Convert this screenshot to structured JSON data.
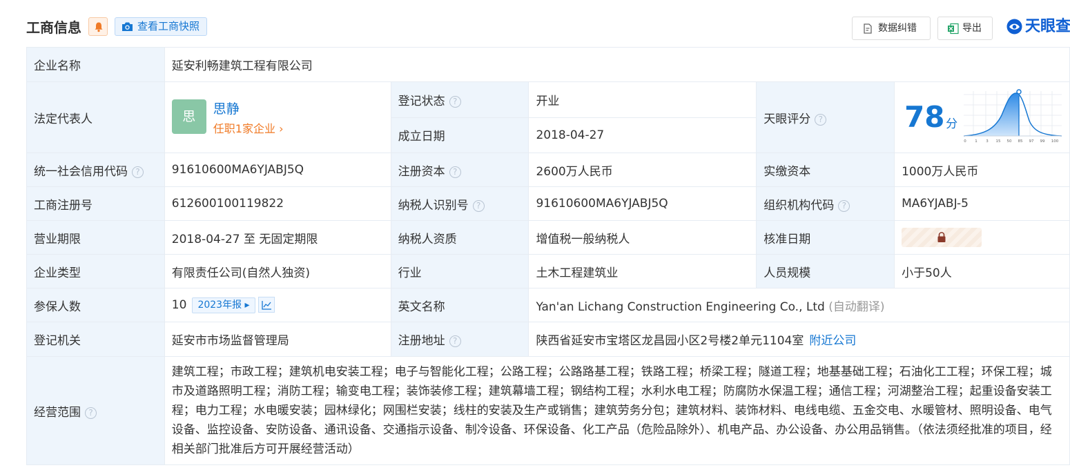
{
  "header": {
    "title": "工商信息",
    "snapshot_label": "查看工商快照",
    "correct_label": "数据纠错",
    "export_label": "导出",
    "logo_text": "天眼查"
  },
  "rows": {
    "company_name": {
      "label": "企业名称",
      "value": "延安利畅建筑工程有限公司"
    },
    "legal_rep": {
      "label": "法定代表人",
      "avatar_char": "思",
      "name": "思静",
      "sub": "任职1家企业 ›"
    },
    "reg_status": {
      "label": "登记状态",
      "value": "开业"
    },
    "found_date": {
      "label": "成立日期",
      "value": "2018-04-27"
    },
    "tianyan_score": {
      "label": "天眼评分",
      "value": "78",
      "unit": "分",
      "axis_ticks": [
        "0",
        "1",
        "3",
        "15",
        "50",
        "85",
        "97",
        "99",
        "100"
      ]
    },
    "credit_code": {
      "label": "统一社会信用代码",
      "value": "91610600MA6YJABJ5Q"
    },
    "reg_capital": {
      "label": "注册资本",
      "value": "2600万人民币"
    },
    "paid_capital": {
      "label": "实缴资本",
      "value": "1000万人民币"
    },
    "reg_number": {
      "label": "工商注册号",
      "value": "612600100119822"
    },
    "taxpayer_id": {
      "label": "纳税人识别号",
      "value": "91610600MA6YJABJ5Q"
    },
    "org_code": {
      "label": "组织机构代码",
      "value": "MA6YJABJ-5"
    },
    "biz_term": {
      "label": "营业期限",
      "value": "2018-04-27 至 无固定期限"
    },
    "taxpayer_qual": {
      "label": "纳税人资质",
      "value": "增值税一般纳税人"
    },
    "approve_date": {
      "label": "核准日期"
    },
    "company_type": {
      "label": "企业类型",
      "value": "有限责任公司(自然人独资)"
    },
    "industry": {
      "label": "行业",
      "value": "土木工程建筑业"
    },
    "staff_size": {
      "label": "人员规模",
      "value": "小于50人"
    },
    "insured": {
      "label": "参保人数",
      "value": "10",
      "year_badge": "2023年报 ▸"
    },
    "english_name": {
      "label": "英文名称",
      "value": "Yan'an Lichang Construction Engineering Co., Ltd",
      "note": "(自动翻译)"
    },
    "reg_authority": {
      "label": "登记机关",
      "value": "延安市市场监督管理局"
    },
    "reg_address": {
      "label": "注册地址",
      "value": "陕西省延安市宝塔区龙昌园小区2号楼2单元1104室",
      "link": "附近公司"
    },
    "biz_scope": {
      "label": "经营范围",
      "value": "建筑工程；市政工程；建筑机电安装工程；电子与智能化工程；公路工程；公路路基工程；铁路工程；桥梁工程；隧道工程；地基基础工程；石油化工工程；环保工程；城市及道路照明工程；消防工程；输变电工程；装饰装修工程；建筑幕墙工程；钢结构工程；水利水电工程；防腐防水保温工程；通信工程；河湖整治工程；起重设备安装工程；电力工程；水电暖安装；园林绿化；网围栏安装；线柱的安装及生产或销售；建筑劳务分包；建筑材料、装饰材料、电线电缆、五金交电、水暖管材、照明设备、电气设备、监控设备、安防设备、通讯设备、交通指示设备、制冷设备、环保设备、化工产品（危险品除外）、机电产品、办公设备、办公用品销售。（依法须经批准的项目，经相关部门批准后方可开展经营活动）"
    }
  },
  "colors": {
    "accent": "#1677d2",
    "label_bg": "#eef5fc",
    "open_green": "#36a058",
    "orange": "#f07a26"
  }
}
